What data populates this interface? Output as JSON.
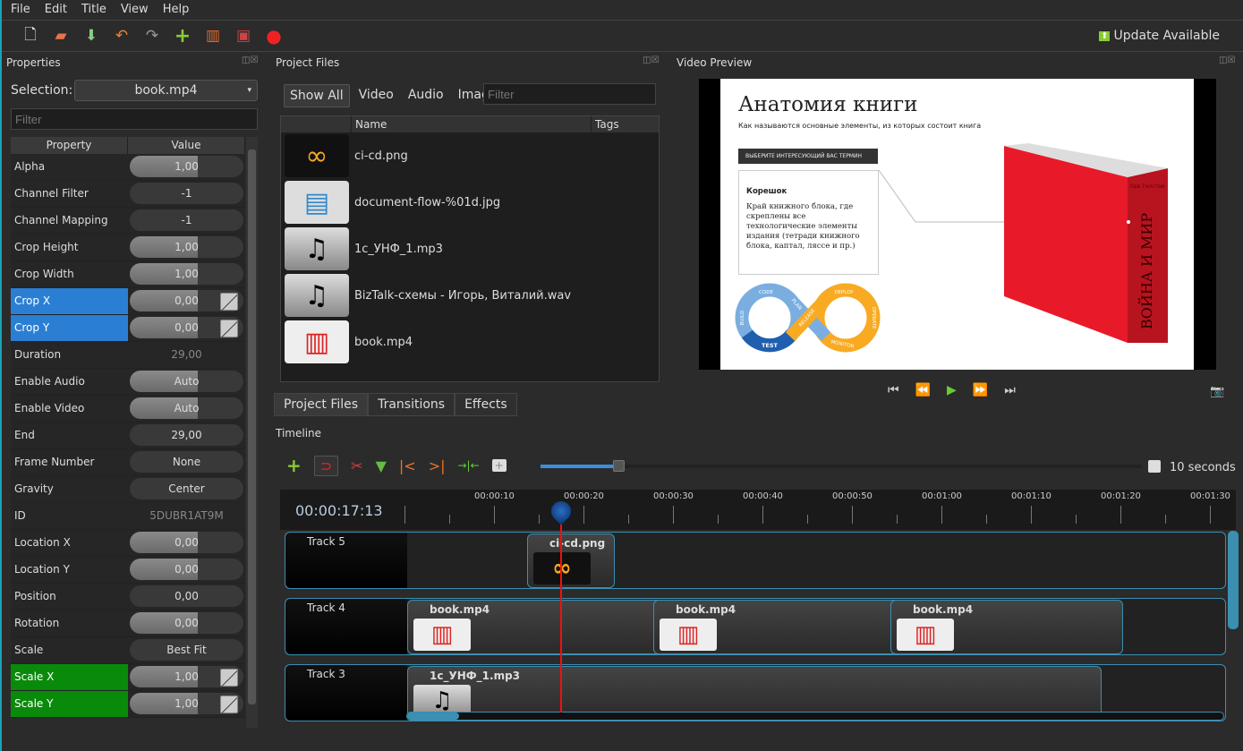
{
  "menu": [
    "File",
    "Edit",
    "Title",
    "View",
    "Help"
  ],
  "toolbar": {
    "icons": [
      "new-project-icon",
      "open-project-icon",
      "save-project-icon",
      "undo-icon",
      "redo-icon",
      "import-files-icon",
      "profile-icon",
      "fullscreen-icon",
      "export-video-icon"
    ],
    "update": "Update Available"
  },
  "properties": {
    "title": "Properties",
    "selection_label": "Selection:",
    "selection_value": "book.mp4",
    "filter_placeholder": "Filter",
    "col_property": "Property",
    "col_value": "Value",
    "rows": [
      {
        "k": "Alpha",
        "v": "1,00",
        "t": "lt"
      },
      {
        "k": "Channel Filter",
        "v": "-1",
        "t": ""
      },
      {
        "k": "Channel Mapping",
        "v": "-1",
        "t": ""
      },
      {
        "k": "Crop Height",
        "v": "1,00",
        "t": "lt"
      },
      {
        "k": "Crop Width",
        "v": "1,00",
        "t": "lt"
      },
      {
        "k": "Crop X",
        "v": "0,00",
        "t": "sel"
      },
      {
        "k": "Crop Y",
        "v": "0,00",
        "t": "sel"
      },
      {
        "k": "Duration",
        "v": "29,00",
        "t": "ro"
      },
      {
        "k": "Enable Audio",
        "v": "Auto",
        "t": "lt"
      },
      {
        "k": "Enable Video",
        "v": "Auto",
        "t": "lt"
      },
      {
        "k": "End",
        "v": "29,00",
        "t": ""
      },
      {
        "k": "Frame Number",
        "v": "None",
        "t": ""
      },
      {
        "k": "Gravity",
        "v": "Center",
        "t": ""
      },
      {
        "k": "ID",
        "v": "5DUBR1AT9M",
        "t": "ro"
      },
      {
        "k": "Location X",
        "v": "0,00",
        "t": "lt"
      },
      {
        "k": "Location Y",
        "v": "0,00",
        "t": "lt"
      },
      {
        "k": "Position",
        "v": "0,00",
        "t": ""
      },
      {
        "k": "Rotation",
        "v": "0,00",
        "t": "lt"
      },
      {
        "k": "Scale",
        "v": "Best Fit",
        "t": ""
      },
      {
        "k": "Scale X",
        "v": "1,00",
        "t": "grn"
      },
      {
        "k": "Scale Y",
        "v": "1,00",
        "t": "grn"
      }
    ]
  },
  "project_files": {
    "title": "Project Files",
    "filters": [
      "Show All",
      "Video",
      "Audio",
      "Image"
    ],
    "filter_placeholder": "Filter",
    "col_name": "Name",
    "col_tags": "Tags",
    "files": [
      {
        "name": "ci-cd.png",
        "icon": "infinity-icon"
      },
      {
        "name": "document-flow-%01d.jpg",
        "icon": "image-icon"
      },
      {
        "name": "1с_УНФ_1.mp3",
        "icon": "music-icon"
      },
      {
        "name": "BizTalk-схемы - Игорь, Виталий.wav",
        "icon": "music-icon"
      },
      {
        "name": "book.mp4",
        "icon": "video-icon"
      }
    ],
    "tabs": [
      "Project Files",
      "Transitions",
      "Effects"
    ]
  },
  "preview": {
    "title": "Video Preview",
    "slide_title": "Анатомия книги",
    "slide_subtitle": "Как называются основные элементы, из которых состоит книга",
    "dropdown": "ВЫБЕРИТЕ ИНТЕРЕСУЮЩИЙ ВАС ТЕРМИН",
    "term": "Корешок",
    "definition": "Край книжного блока, где скреплены все технологические элементы издания (тетради книжного блока, каптал, ляссе и пр.)",
    "book_author": "Лев Толстой",
    "book_title": "ВОЙНА И МИР",
    "cycle": [
      "CODE",
      "BUILD",
      "TEST",
      "PLAN",
      "RELEASE",
      "DEPLOY",
      "OPERATE",
      "MONITOR"
    ]
  },
  "timeline": {
    "title": "Timeline",
    "time": "00:00:17:13",
    "zoom_label": "10 seconds",
    "zoom_fraction": 0.13,
    "ticks": [
      "00:00:10",
      "00:00:20",
      "00:00:30",
      "00:00:40",
      "00:00:50",
      "00:01:00",
      "00:01:10",
      "00:01:20",
      "00:01:30"
    ],
    "tracks": [
      {
        "name": "Track 5",
        "clips": [
          {
            "name": "ci-cd.png",
            "start": 13.6,
            "end": 23.4,
            "icon": "infinity-icon"
          }
        ]
      },
      {
        "name": "Track 4",
        "clips": [
          {
            "name": "book.mp4",
            "start": 0.2,
            "end": 29,
            "icon": "video-icon"
          },
          {
            "name": "book.mp4",
            "start": 27.7,
            "end": 56,
            "icon": "video-icon"
          },
          {
            "name": "book.mp4",
            "start": 54.2,
            "end": 80.2,
            "icon": "video-icon"
          }
        ]
      },
      {
        "name": "Track 3",
        "clips": [
          {
            "name": "1с_УНФ_1.mp3",
            "start": 0.2,
            "end": 77.8,
            "icon": "music-icon"
          }
        ]
      }
    ]
  }
}
